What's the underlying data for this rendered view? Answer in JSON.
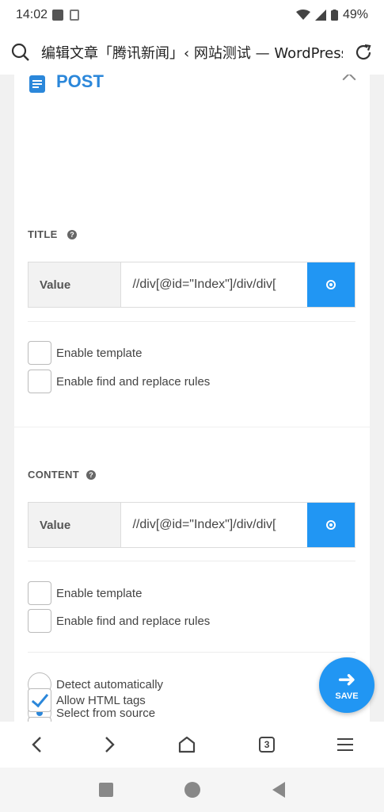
{
  "status": {
    "time": "14:02",
    "battery": "49%"
  },
  "browser": {
    "url_text": "编辑文章「腾讯新闻」‹ 网站测试 — WordPress",
    "tab_count": "3"
  },
  "panel": {
    "title": "POST",
    "title_section": {
      "label": "TITLE",
      "help": "?",
      "field_label": "Value",
      "field_value": "//div[@id=\"Index\"]/div/div[",
      "checks": [
        "Enable template",
        "Enable find and replace rules"
      ]
    },
    "content_section": {
      "label": "CONTENT",
      "help": "?",
      "field_label": "Value",
      "field_value": "//div[@id=\"Index\"]/div/div[",
      "checks": [
        "Enable template",
        "Enable find and replace rules"
      ],
      "radios": [
        "Detect automatically",
        "Select from source"
      ],
      "radio_selected": "Select from source",
      "allow_html_label": "Allow HTML tags",
      "allow_html_checked": true
    }
  },
  "save_button": {
    "label": "SAVE",
    "icon": "arrow-right-icon"
  },
  "colors": {
    "accent": "#2196f3",
    "title_blue": "#2b87da"
  }
}
